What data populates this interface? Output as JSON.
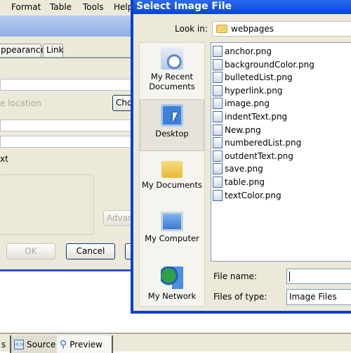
{
  "menubar": {
    "items": [
      "Format",
      "Table",
      "Tools",
      "Help"
    ]
  },
  "back_dialog": {
    "tabs": [
      "ppearance",
      "Link"
    ],
    "location_placeholder": "e location",
    "choose_button": "Cho",
    "section_label": "xt",
    "advanced_button": "Advan",
    "ok_button": "OK",
    "cancel_button": "Cancel"
  },
  "bottom_tabs": {
    "left_fragment": "s",
    "source": "Source",
    "preview": "Preview"
  },
  "select_dialog": {
    "title": "Select Image File",
    "look_in_label": "Look in:",
    "look_in_value": "webpages",
    "places": [
      {
        "label": "My Recent Documents",
        "icon": "recent-documents-icon"
      },
      {
        "label": "Desktop",
        "icon": "desktop-icon",
        "selected": true
      },
      {
        "label": "My Documents",
        "icon": "my-documents-icon"
      },
      {
        "label": "My Computer",
        "icon": "my-computer-icon"
      },
      {
        "label": "My Network",
        "icon": "my-network-icon"
      }
    ],
    "files": [
      "anchor.png",
      "backgroundColor.png",
      "bulletedList.png",
      "hyperlink.png",
      "image.png",
      "indentText.png",
      "New.png",
      "numberedList.png",
      "outdentText.png",
      "save.png",
      "table.png",
      "textColor.png"
    ],
    "file_name_label": "File name:",
    "file_name_value": "",
    "files_of_type_label": "Files of type:",
    "files_of_type_value": "Image Files"
  }
}
